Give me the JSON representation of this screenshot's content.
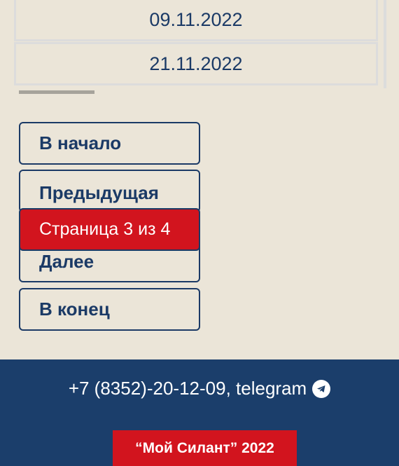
{
  "table": {
    "rows": [
      "09.11.2022",
      "21.11.2022"
    ]
  },
  "pagination": {
    "first": "В начало",
    "previous": "Предыдущая",
    "current": "Страница 3 из 4",
    "next": "Далее",
    "last": "В конец"
  },
  "footer": {
    "contacts": "+7 (8352)-20-12-09, telegram",
    "telegram_icon": "telegram-icon",
    "brand": "“Мой Силант” 2022"
  },
  "colors": {
    "background": "#ebe5d8",
    "primary": "#1b3a66",
    "accent": "#d2141e",
    "footer": "#1b3e6b"
  }
}
